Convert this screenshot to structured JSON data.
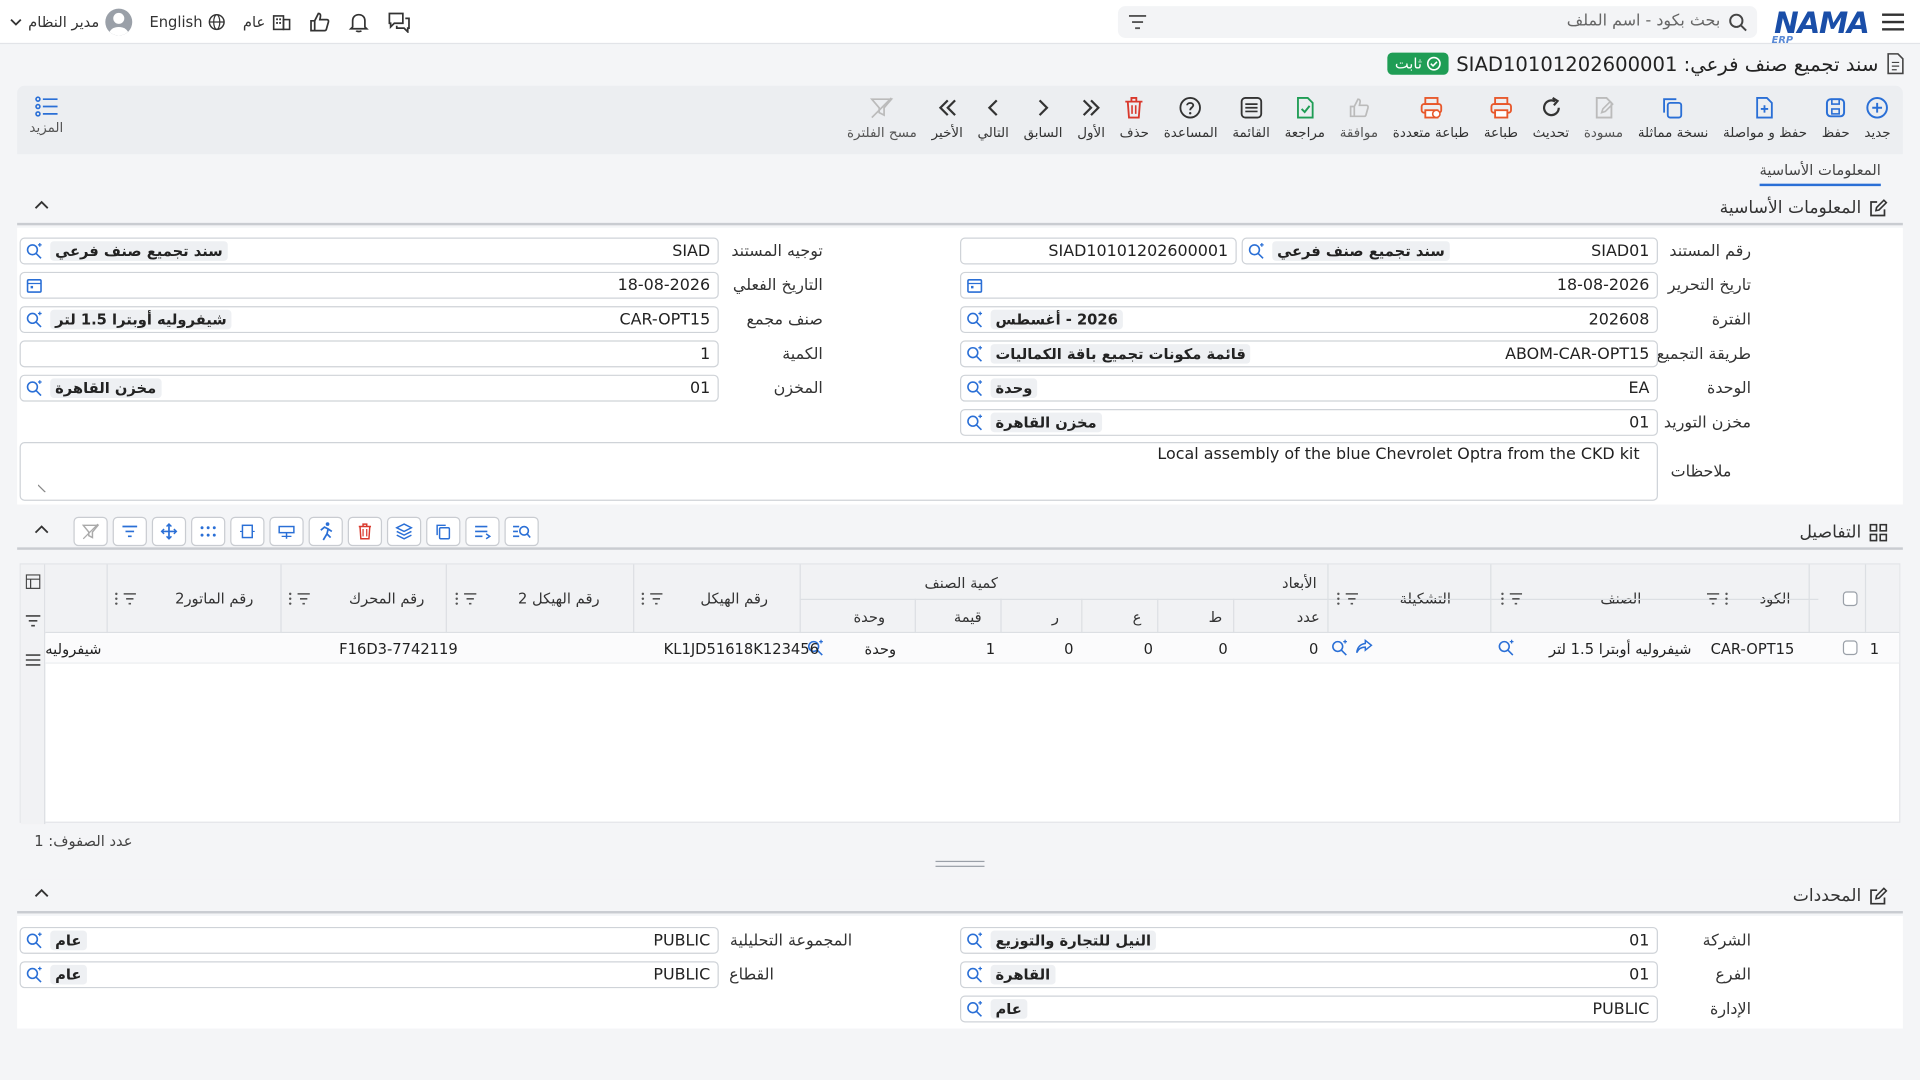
{
  "topbar": {
    "logo": "NAMA",
    "logo_sub": "ERP",
    "search_placeholder": "بحث بكود - اسم الملف",
    "user": "مدير النظام",
    "language": "English",
    "scope": "عام"
  },
  "document": {
    "title": "سند تجميع صنف فرعي: SIAD10101202600001",
    "status": "ثابت"
  },
  "toolbar": {
    "buttons": [
      {
        "label": "جديد",
        "icon": "plus-circle-icon"
      },
      {
        "label": "حفظ",
        "icon": "save-icon"
      },
      {
        "label": "حفظ و مواصلة",
        "icon": "save-continue-icon"
      },
      {
        "label": "نسخة مماثلة",
        "icon": "copy-icon"
      },
      {
        "label": "مسودة",
        "icon": "draft-icon"
      },
      {
        "label": "تحديث",
        "icon": "refresh-icon"
      },
      {
        "label": "طباعة",
        "icon": "print-icon"
      },
      {
        "label": "طباعة متعددة",
        "icon": "multi-print-icon"
      },
      {
        "label": "موافقة",
        "icon": "thumb-up-icon"
      },
      {
        "label": "مراجعة",
        "icon": "review-icon"
      },
      {
        "label": "القائمة",
        "icon": "list-icon"
      },
      {
        "label": "المساعدة",
        "icon": "help-icon"
      },
      {
        "label": "حذف",
        "icon": "trash-icon"
      },
      {
        "label": "الأول",
        "icon": "first-icon"
      },
      {
        "label": "السابق",
        "icon": "previous-icon"
      },
      {
        "label": "التالي",
        "icon": "next-icon"
      },
      {
        "label": "الأخير",
        "icon": "last-icon"
      },
      {
        "label": "مسح الفلترة",
        "icon": "clear-filter-icon"
      }
    ],
    "more_label": "المزيد"
  },
  "tabs": {
    "basic": "المعلومات الأساسية"
  },
  "sections": {
    "basic": "المعلومات الأساسية",
    "details": "التفاصيل",
    "dimensions": "المحددات"
  },
  "fields": {
    "doc_no": {
      "label": "رقم المستند",
      "code": "SIAD01",
      "desc": "سند تجميع صنف فرعي",
      "number": "SIAD10101202600001"
    },
    "doc_date": {
      "label": "تاريخ التحرير",
      "value": "18-08-2026"
    },
    "period": {
      "label": "الفترة",
      "value": "202608",
      "desc": "2026 - أغسطس"
    },
    "assembly_method": {
      "label": "طريقة التجميع",
      "value": "ABOM-CAR-OPT15",
      "desc": "قائمة مكونات تجميع باقة الكماليات"
    },
    "unit": {
      "label": "الوحدة",
      "value": "EA",
      "desc": "وحدة"
    },
    "supply_store": {
      "label": "مخزن التوريد",
      "value": "01",
      "desc": "مخزن القاهرة"
    },
    "doc_direction": {
      "label": "توجيه المستند",
      "value": "SIAD",
      "desc": "سند تجميع صنف فرعي"
    },
    "actual_date": {
      "label": "التاريخ الفعلي",
      "value": "18-08-2026"
    },
    "assembled_item": {
      "label": "صنف مجمع",
      "value": "CAR-OPT15",
      "desc": "شيفروليه أوبترا 1.5 لتر"
    },
    "quantity": {
      "label": "الكمية",
      "value": "1"
    },
    "store": {
      "label": "المخزن",
      "value": "01",
      "desc": "مخزن القاهرة"
    },
    "notes": {
      "label": "ملاحظات",
      "value": "Local assembly of the blue Chevrolet Optra from the CKD kit"
    }
  },
  "grid": {
    "headers": {
      "code": "الكود",
      "item": "الصنف",
      "config": "التشكيلة",
      "dimensions": "الأبعاد",
      "count": "عدد",
      "l": "ط",
      "w": "ع",
      "r": "ر",
      "item_qty": "كمية الصنف",
      "qty_value": "قيمة",
      "qty_unit": "وحدة",
      "chassis": "رقم الهيكل",
      "chassis2": "رقم الهيكل 2",
      "engine": "رقم المحرك",
      "engine2": "رقم الماتور2"
    },
    "rows": [
      {
        "n": "1",
        "code": "CAR-OPT15",
        "item": "شيفروليه أوبترا 1.5 لتر",
        "count": "0",
        "l": "0",
        "w": "0",
        "r": "0",
        "qty": "1",
        "unit": "وحدة",
        "chassis": "KL1JD51618K123456",
        "chassis2": "",
        "engine": "F16D3-7742119",
        "engine2": "شيفروليه"
      }
    ],
    "row_count_label": "عدد الصفوف: 1"
  },
  "dimensions": {
    "company": {
      "label": "الشركة",
      "value": "01",
      "desc": "النيل للتجارة والتوزيع"
    },
    "branch": {
      "label": "الفرع",
      "value": "01",
      "desc": "القاهرة"
    },
    "department": {
      "label": "الإدارة",
      "value": "PUBLIC",
      "desc": "عام"
    },
    "analytic_group": {
      "label": "المجموعة التحليلية",
      "value": "PUBLIC",
      "desc": "عام"
    },
    "sector": {
      "label": "القطاع",
      "value": "PUBLIC",
      "desc": "عام"
    }
  },
  "colors": {
    "accent": "#2a6fd6",
    "brand": "#1a4ea8",
    "status": "#1f9d55",
    "danger": "#d9382c",
    "print": "#e8572a",
    "review": "#1f9d55"
  }
}
